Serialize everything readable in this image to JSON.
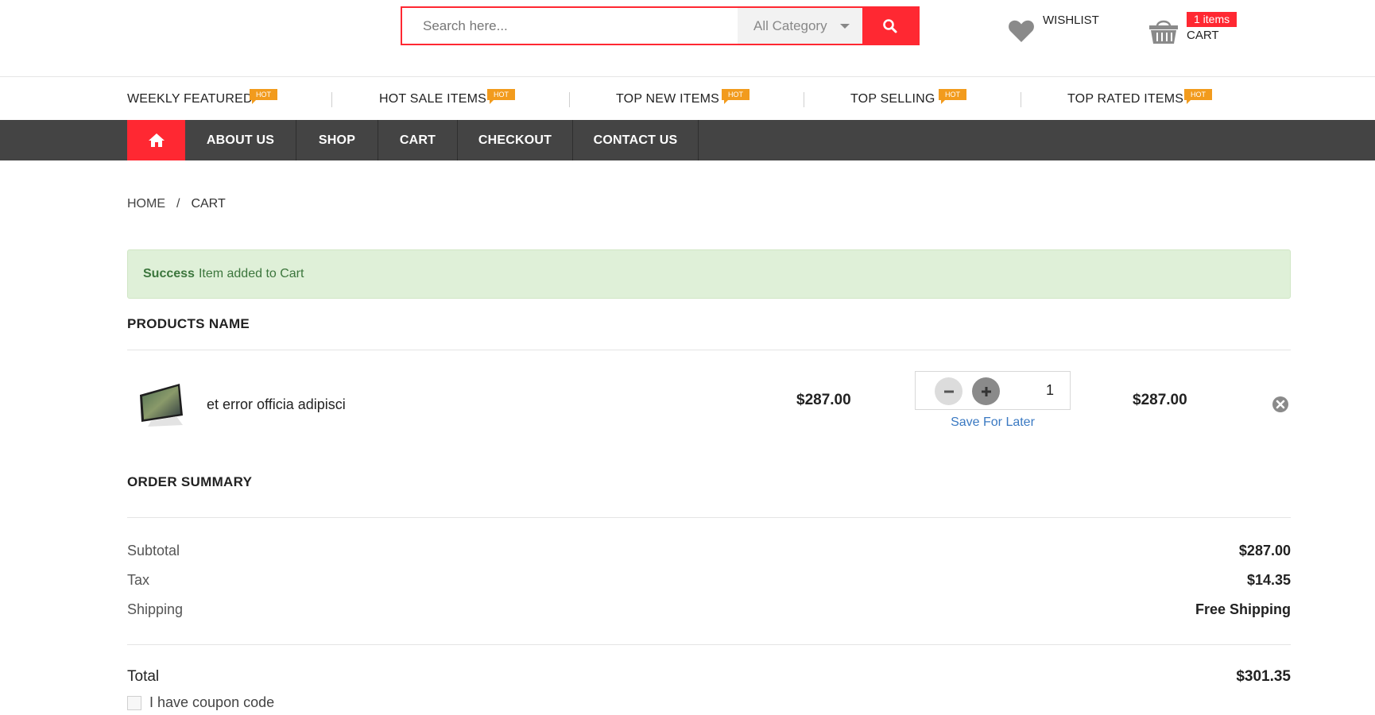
{
  "header": {
    "search_placeholder": "Search here...",
    "category_label": "All Category",
    "wishlist_label": "WISHLIST",
    "cart_badge": "1 items",
    "cart_label": "CART",
    "accent_color": "#ff2832"
  },
  "hot_items": [
    {
      "label": "WEEKLY FEATURED",
      "tag": "HOT"
    },
    {
      "label": "HOT SALE ITEMS",
      "tag": "HOT"
    },
    {
      "label": "TOP NEW ITEMS",
      "tag": "HOT"
    },
    {
      "label": "TOP SELLING",
      "tag": "HOT"
    },
    {
      "label": "TOP RATED ITEMS",
      "tag": "HOT"
    }
  ],
  "nav": {
    "home_icon": "home-icon",
    "items": [
      "ABOUT US",
      "SHOP",
      "CART",
      "CHECKOUT",
      "CONTACT US"
    ]
  },
  "breadcrumb": {
    "home": "HOME",
    "separator": "/",
    "current": "CART"
  },
  "alert": {
    "strong": "Success",
    "message": "Item added to Cart"
  },
  "products": {
    "title": "PRODUCTS NAME",
    "items": [
      {
        "name": "et error officia adipisci",
        "price": "$287.00",
        "quantity": "1",
        "save_for_later": "Save For Later",
        "total": "$287.00"
      }
    ]
  },
  "summary": {
    "title": "ORDER SUMMARY",
    "subtotal_label": "Subtotal",
    "subtotal_value": "$287.00",
    "tax_label": "Tax",
    "tax_value": "$14.35",
    "shipping_label": "Shipping",
    "shipping_value": "Free Shipping",
    "total_label": "Total",
    "total_value": "$301.35",
    "coupon_label": "I have coupon code"
  }
}
